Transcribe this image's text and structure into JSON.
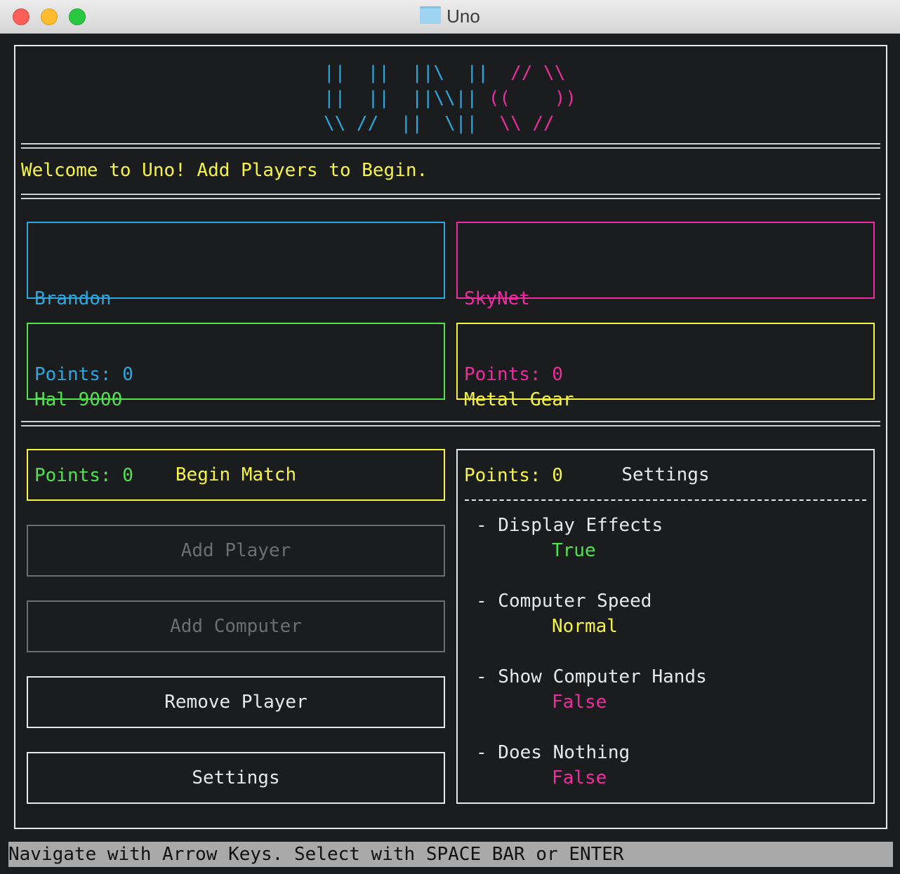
{
  "window": {
    "title": "Uno",
    "folder_icon": "folder-icon"
  },
  "logo": {
    "lines": [
      [
        {
          "t": "||  ||  ||\\  ||",
          "c": "blue"
        },
        {
          "t": "  // \\\\",
          "c": "pink"
        }
      ],
      [
        {
          "t": "||  ||  ||\\\\||",
          "c": "blue"
        },
        {
          "t": " ((    ))",
          "c": "pink"
        }
      ],
      [
        {
          "t": "\\\\ //  ||  \\||",
          "c": "blue"
        },
        {
          "t": "  \\\\ //",
          "c": "pink"
        }
      ]
    ]
  },
  "welcome": "Welcome to Uno! Add Players to Begin.",
  "players": [
    {
      "name": "Brandon",
      "points_label": "Points: 0",
      "color": "#2aa8e0"
    },
    {
      "name": "SkyNet",
      "points_label": "Points: 0",
      "color": "#f02aa0"
    },
    {
      "name": "Hal 9000",
      "points_label": "Points: 0",
      "color": "#4fe34f"
    },
    {
      "name": "Metal Gear",
      "points_label": "Points: 0",
      "color": "#f5f542"
    }
  ],
  "menu": {
    "begin_match": "Begin Match",
    "add_player": "Add Player",
    "add_computer": "Add Computer",
    "remove_player": "Remove Player",
    "settings": "Settings"
  },
  "settings": {
    "title": "Settings",
    "items": [
      {
        "name": "- Display Effects",
        "value": "True",
        "value_color": "#4fe34f"
      },
      {
        "name": "- Computer Speed",
        "value": "Normal",
        "value_color": "#f5f542"
      },
      {
        "name": "- Show Computer Hands",
        "value": "False",
        "value_color": "#f02aa0"
      },
      {
        "name": "- Does Nothing",
        "value": "False",
        "value_color": "#f02aa0"
      }
    ]
  },
  "status": "Navigate with Arrow Keys. Select with SPACE BAR or ENTER"
}
